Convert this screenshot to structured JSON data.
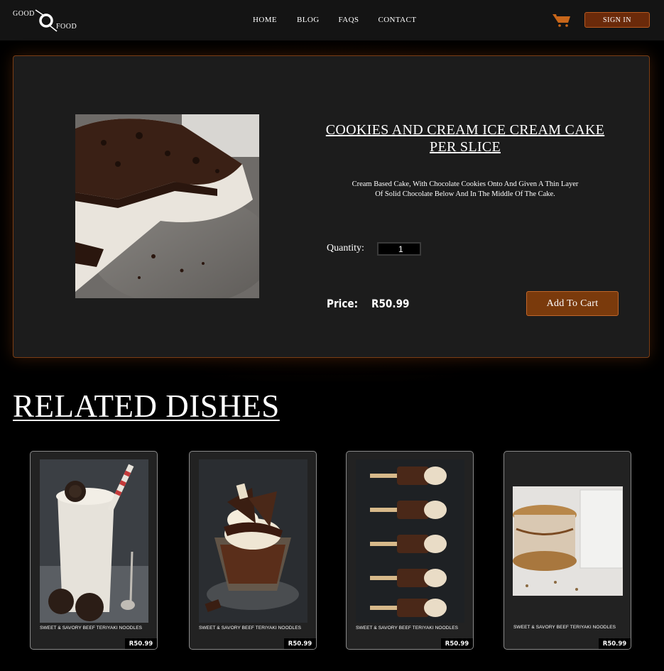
{
  "nav": {
    "logo_top": "GOOD",
    "logo_bottom": "FOOD",
    "links": [
      "HOME",
      "BLOG",
      "FAQS",
      "CONTACT"
    ],
    "signin_label": "SIGN IN",
    "cart_icon": "shopping-cart-icon"
  },
  "product": {
    "title": "COOKIES AND CREAM ICE CREAM CAKE PER SLICE",
    "description": "Cream Based Cake, With Chocolate Cookies Onto And Given A Thin Layer Of Solid Chocolate Below And In The Middle Of  The Cake.",
    "quantity_label": "Quantity:",
    "quantity_value": "1",
    "price_label": "Price:",
    "price_value": "R50.99",
    "add_to_cart_label": "Add To Cart"
  },
  "related": {
    "heading": "RELATED DISHES",
    "cards": [
      {
        "name": "SWEET & SAVORY BEEF TERIYAKI NOODLES",
        "price": "R50.99",
        "image": "cookies-milkshake"
      },
      {
        "name": "SWEET & SAVORY BEEF TERIYAKI NOODLES",
        "price": "R50.99",
        "image": "chocolate-sundae"
      },
      {
        "name": "SWEET & SAVORY BEEF TERIYAKI NOODLES",
        "price": "R50.99",
        "image": "smores-pops"
      },
      {
        "name": "SWEET & SAVORY BEEF TERIYAKI NOODLES",
        "price": "R50.99",
        "image": "ice-cream-sandwich"
      }
    ]
  },
  "colors": {
    "accent": "#7a3a0c",
    "accent_border": "#c0662a",
    "panel_bg": "#1c1c1c",
    "nav_bg": "#141414"
  }
}
